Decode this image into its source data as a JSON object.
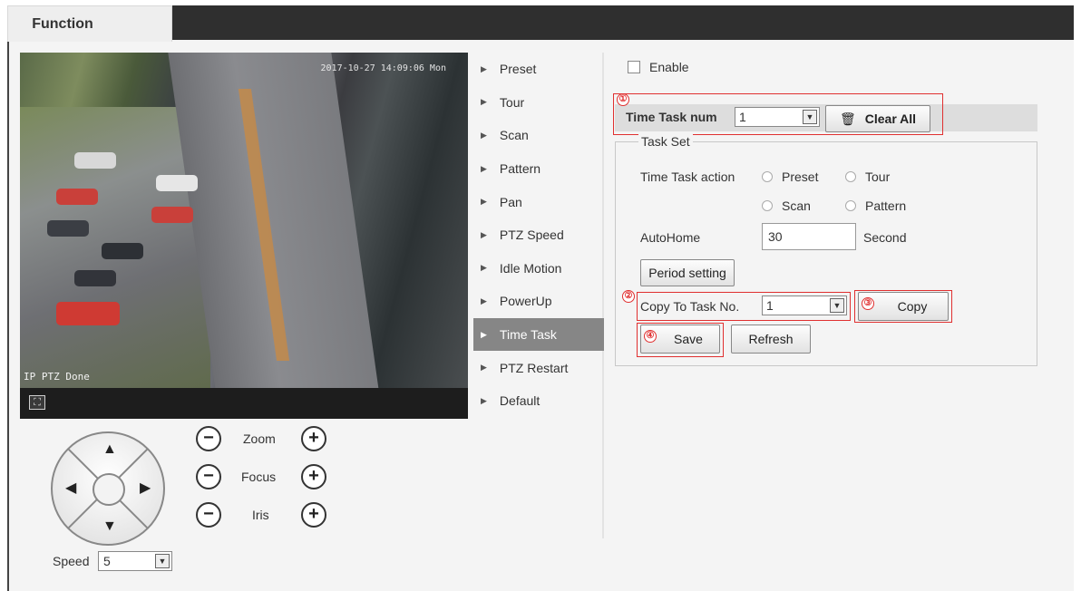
{
  "tab": {
    "label": "Function"
  },
  "video": {
    "timestamp": "2017-10-27 14:09:06 Mon",
    "status_text": "IP PTZ Done",
    "fullscreen_icon": "fullscreen-icon"
  },
  "ptz": {
    "zoom_label": "Zoom",
    "focus_label": "Focus",
    "iris_label": "Iris",
    "minus": "−",
    "plus": "+",
    "speed_label": "Speed",
    "speed_value": "5",
    "arrow_up": "▲",
    "arrow_down": "▼",
    "arrow_left": "◀",
    "arrow_right": "▶"
  },
  "menu": {
    "items": [
      {
        "label": "Preset"
      },
      {
        "label": "Tour"
      },
      {
        "label": "Scan"
      },
      {
        "label": "Pattern"
      },
      {
        "label": "Pan"
      },
      {
        "label": "PTZ Speed"
      },
      {
        "label": "Idle Motion"
      },
      {
        "label": "PowerUp"
      },
      {
        "label": "Time Task"
      },
      {
        "label": "PTZ Restart"
      },
      {
        "label": "Default"
      }
    ],
    "active_index": 8
  },
  "panel": {
    "enable_label": "Enable",
    "time_task_num_label": "Time Task num",
    "time_task_num_value": "1",
    "clear_all_label": "Clear All",
    "task_set_legend": "Task Set",
    "time_task_action_label": "Time Task action",
    "actions": [
      "Preset",
      "Tour",
      "Scan",
      "Pattern"
    ],
    "autohome_label": "AutoHome",
    "autohome_value": "30",
    "autohome_unit": "Second",
    "period_setting_label": "Period setting",
    "copy_to_label": "Copy To Task No.",
    "copy_to_value": "1",
    "copy_label": "Copy",
    "save_label": "Save",
    "refresh_label": "Refresh",
    "markers": [
      "①",
      "②",
      "③",
      "④"
    ]
  },
  "colors": {
    "topbar": "#2f2f2f",
    "active_menu": "#868686",
    "highlight_box": "#e03030"
  }
}
